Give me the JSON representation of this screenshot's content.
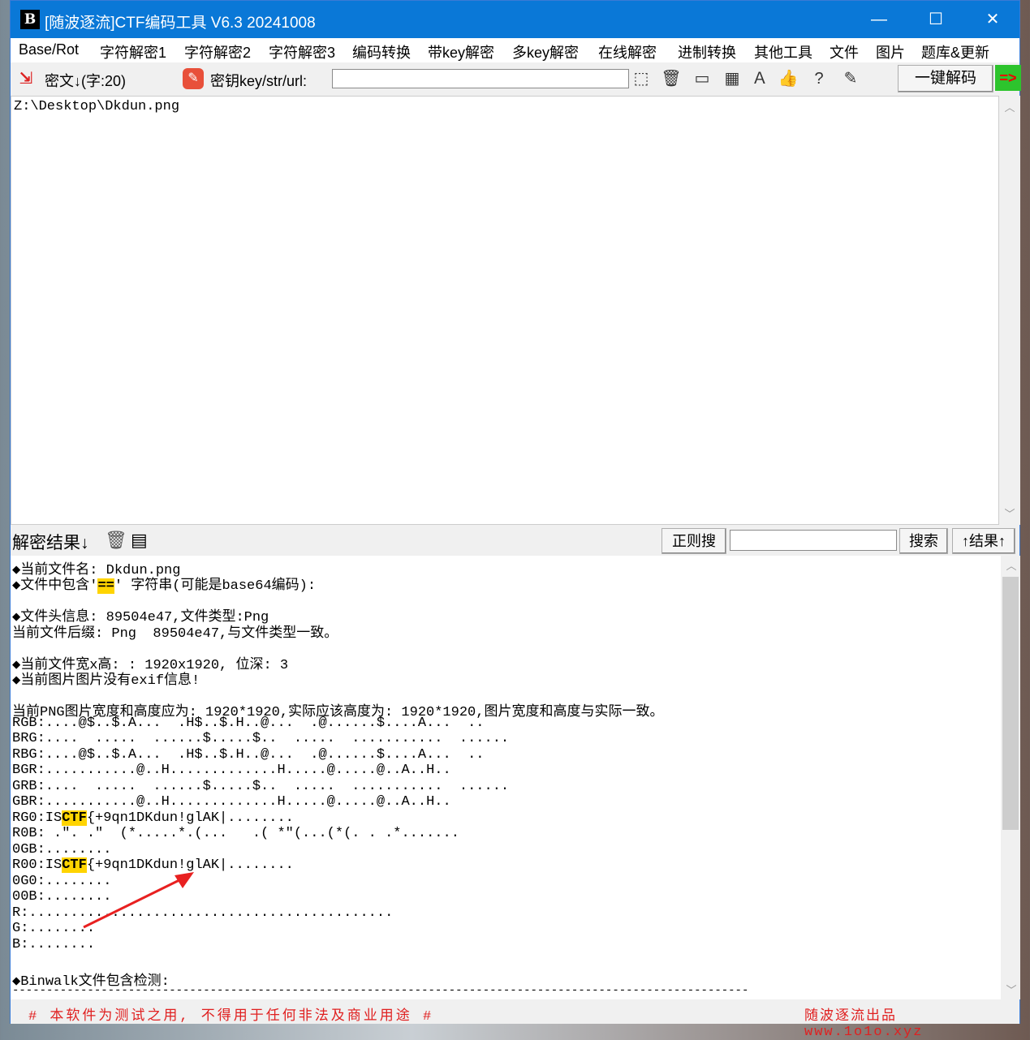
{
  "window": {
    "app_icon": "B",
    "title": "[随波逐流]CTF编码工具 V6.3 20241008",
    "minimize": "—",
    "maximize": "☐",
    "close": "✕"
  },
  "menu": [
    "Base/Rot",
    "字符解密1",
    "字符解密2",
    "字符解密3",
    "编码转换",
    "带key解密",
    "多key解密",
    "在线解密",
    "进制转换",
    "其他工具",
    "文件",
    "图片",
    "题库&更新"
  ],
  "toolbar": {
    "cipher_label": "密文↓(字:20)",
    "key_label": "密钥key/str/url:",
    "key_value": "",
    "decode_button": "一键解码",
    "arrow_button": "=>",
    "icons": [
      "cursor-icon",
      "trash-icon",
      "terminal-icon",
      "table-icon",
      "text-style-icon",
      "thumbs-up-icon",
      "help-icon",
      "edit-icon"
    ]
  },
  "cipher": {
    "text": "Z:\\Desktop\\Dkdun.png"
  },
  "result": {
    "label": "解密结果↓",
    "regex_button": "正则搜",
    "search_value": "",
    "search_button": "搜索",
    "results_button": "↑结果↑"
  },
  "output": {
    "lines": [
      "◆当前文件名: Dkdun.png",
      "◆文件中包含'==' 字符串(可能是base64编码):",
      "",
      "◆文件头信息: 89504e47,文件类型:Png",
      "当前文件后缀: Png  89504e47,与文件类型一致。",
      "",
      "◆当前文件宽x高: : 1920x1920, 位深: 3",
      "◆当前图片图片没有exif信息!",
      "",
      "当前PNG图片宽度和高度应为: 1920*1920,实际应该高度为: 1920*1920,图片宽度和高度与实际一致。",
      "RGB:....@$..$.A...  .H$..$.H..@...  .@......$....A...  ..",
      "BRG:....  .....  ......$.....$..  .....  ...........  ......",
      "RBG:....@$..$.A...  .H$..$.H..@...  .@......$....A...  ..",
      "BGR:...........@..H.............H.....@.....@..A..H..",
      "GRB:....  .....  ......$.....$..  .....  ...........  ......",
      "GBR:...........@..H.............H.....@.....@..A..H..",
      "RG0:ISCTF{+9qn1DKdun!glAK|........",
      "R0B: .\". .\"  (*.....*.(...   .( *\"(...(*(. . .*.......",
      "0GB:........",
      "R00:ISCTF{+9qn1DKdun!glAK|........",
      "0G0:........",
      "00B:........",
      "R:............................................",
      "G:........",
      "B:........",
      "",
      "◆Binwalk文件包含检测:",
      "------------------------------------------------------------------------------------------------------------"
    ]
  },
  "footer": {
    "left": "# 本软件为测试之用, 不得用于任何非法及商业用途 #",
    "right": "随波逐流出品 www.1o1o.xyz"
  },
  "colors": {
    "titlebar": "#0a78d7",
    "highlight": "#ffd400",
    "footer_text": "#e02020",
    "arrow": "#e02020"
  }
}
